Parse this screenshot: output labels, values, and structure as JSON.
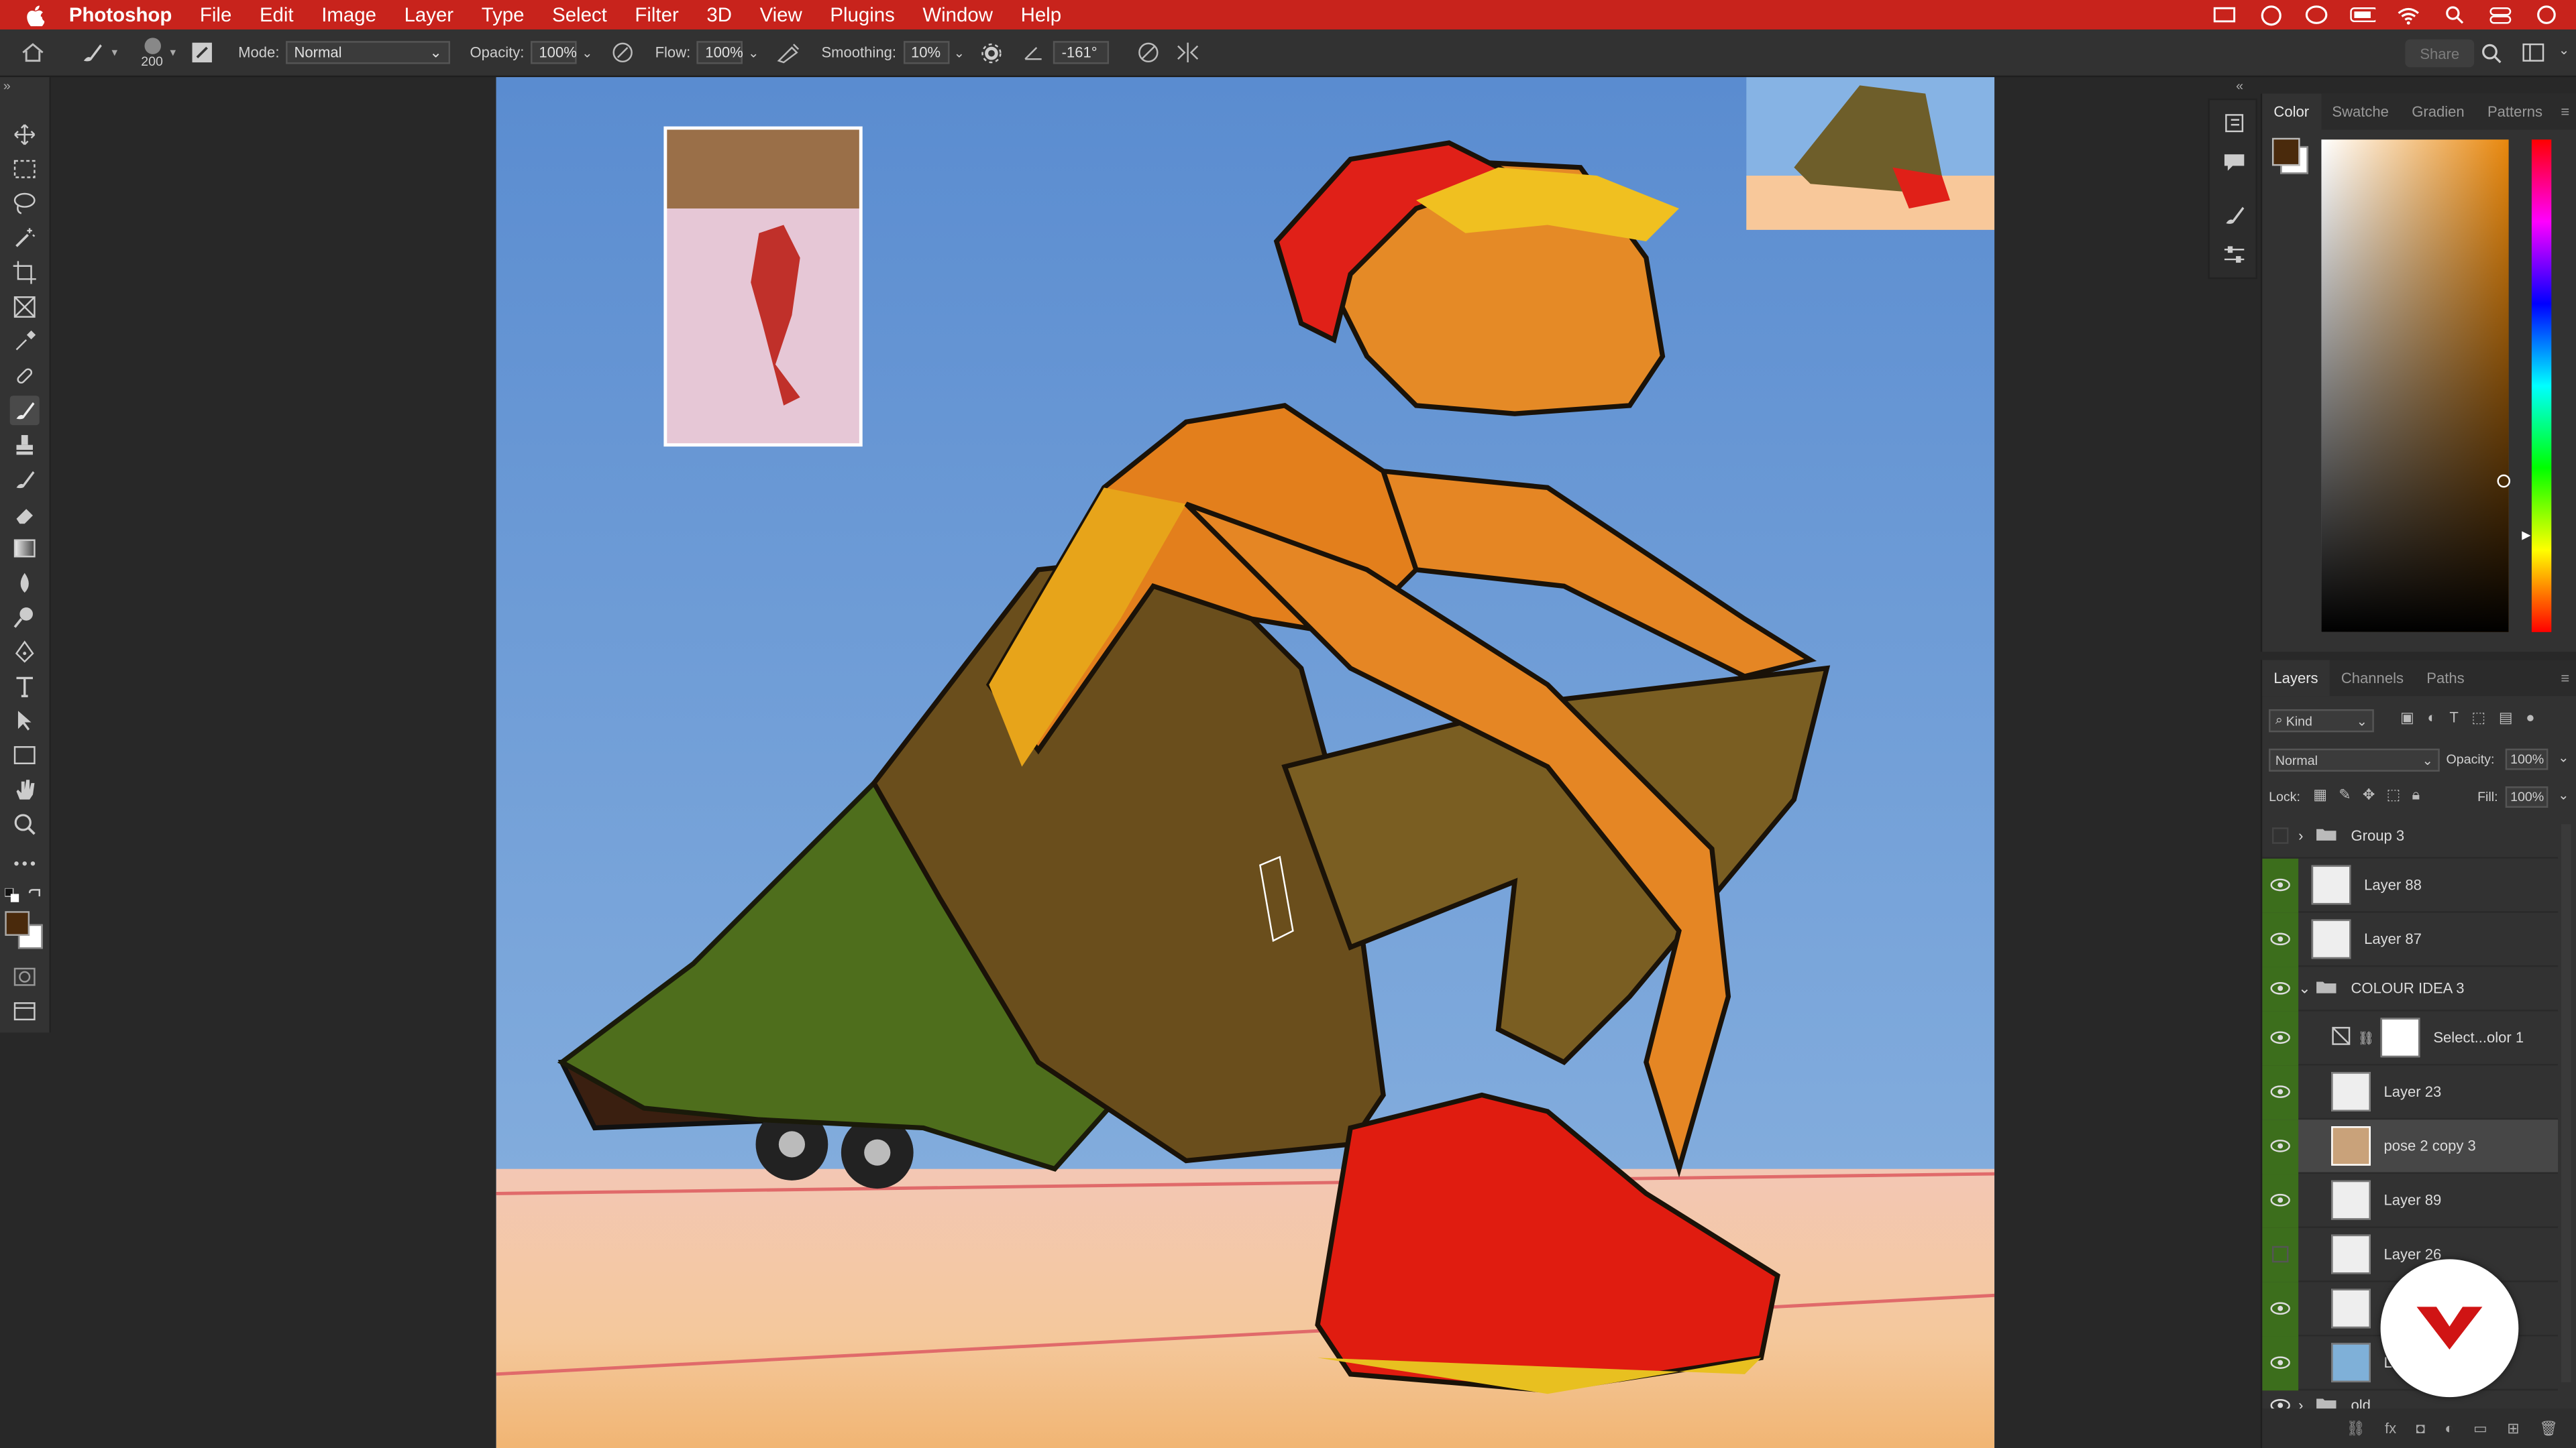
{
  "menubar": {
    "app": "Photoshop",
    "items": [
      "File",
      "Edit",
      "Image",
      "Layer",
      "Type",
      "Select",
      "Filter",
      "3D",
      "View",
      "Plugins",
      "Window",
      "Help"
    ]
  },
  "options": {
    "brush_size": "200",
    "mode_label": "Mode:",
    "mode_value": "Normal",
    "opacity_label": "Opacity:",
    "opacity_value": "100%",
    "flow_label": "Flow:",
    "flow_value": "100%",
    "smoothing_label": "Smoothing:",
    "smoothing_value": "10%",
    "angle_value": "-161°",
    "share_label": "Share"
  },
  "color_panel": {
    "tabs": [
      "Color",
      "Swatche",
      "Gradien",
      "Patterns"
    ],
    "foreground": "#4a2a0c",
    "background": "#ffffff"
  },
  "layers_panel": {
    "tabs": [
      "Layers",
      "Channels",
      "Paths"
    ],
    "filter_kind": "Kind",
    "blend_mode": "Normal",
    "opacity_label": "Opacity:",
    "opacity_value": "100%",
    "lock_label": "Lock:",
    "fill_label": "Fill:",
    "fill_value": "100%",
    "layers": [
      {
        "name": "Group 3",
        "type": "group",
        "visible": false
      },
      {
        "name": "Layer 88",
        "type": "layer",
        "visible": true
      },
      {
        "name": "Layer 87",
        "type": "layer",
        "visible": true
      },
      {
        "name": "COLOUR IDEA 3",
        "type": "group-open",
        "visible": true
      },
      {
        "name": "Select...olor 1",
        "type": "adjustment",
        "visible": true
      },
      {
        "name": "Layer 23",
        "type": "layer",
        "visible": true
      },
      {
        "name": "pose 2 copy 3",
        "type": "layer",
        "visible": true,
        "selected": true
      },
      {
        "name": "Layer 89",
        "type": "layer",
        "visible": true
      },
      {
        "name": "Layer 26",
        "type": "layer",
        "visible": false
      },
      {
        "name": "L",
        "type": "layer",
        "visible": true
      },
      {
        "name": "L",
        "type": "layer",
        "visible": true
      },
      {
        "name": "old",
        "type": "group",
        "visible": true
      }
    ]
  },
  "colors": {
    "menubar": "#c8231c",
    "canvas_sky": "#6d9ad4",
    "accent_green": "#5b8a2a"
  }
}
